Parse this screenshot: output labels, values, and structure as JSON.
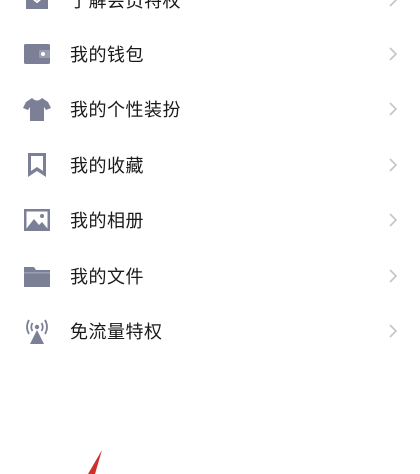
{
  "menu": {
    "icon_color": "#7c8096",
    "chevron_color": "#c4c4c4",
    "items": [
      {
        "label": "了解会员特权",
        "icon": "member-icon"
      },
      {
        "label": "我的钱包",
        "icon": "wallet-icon"
      },
      {
        "label": "我的个性装扮",
        "icon": "tshirt-icon"
      },
      {
        "label": "我的收藏",
        "icon": "bookmark-icon"
      },
      {
        "label": "我的相册",
        "icon": "photo-icon"
      },
      {
        "label": "我的文件",
        "icon": "folder-icon"
      },
      {
        "label": "免流量特权",
        "icon": "signal-tower-icon"
      }
    ]
  },
  "annotation": {
    "color": "#d0302c"
  }
}
